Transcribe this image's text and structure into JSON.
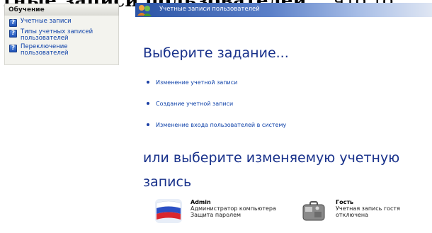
{
  "background_text": {
    "part1": "тные  записи пользователей,",
    "part2": "что то"
  },
  "left_pane": {
    "header": "Обучение",
    "items": [
      {
        "label": "Учетные записи"
      },
      {
        "label": "Типы учетных записей пользователей"
      },
      {
        "label": "Переключение пользователей"
      }
    ]
  },
  "window": {
    "title": "Учетные записи пользователей"
  },
  "main": {
    "heading_task": "Выберите задание...",
    "tasks": [
      {
        "label": "Изменение учетной записи"
      },
      {
        "label": "Создание учетной записи"
      },
      {
        "label": "Изменение входа пользователей в систему"
      }
    ],
    "heading_account": "или выберите изменяемую учетную запись"
  },
  "accounts": [
    {
      "name": "Admin",
      "line1": "Администратор компьютера",
      "line2": "Защита паролем",
      "picture": "russian-flag-icon"
    },
    {
      "name": "Гость",
      "line1": "Учетная запись гостя",
      "line2": "отключена",
      "picture": "suitcase-icon"
    }
  ],
  "colors": {
    "heading": "#17308a",
    "link": "#0b3fa8",
    "titlebar_start": "#2c55a6"
  }
}
